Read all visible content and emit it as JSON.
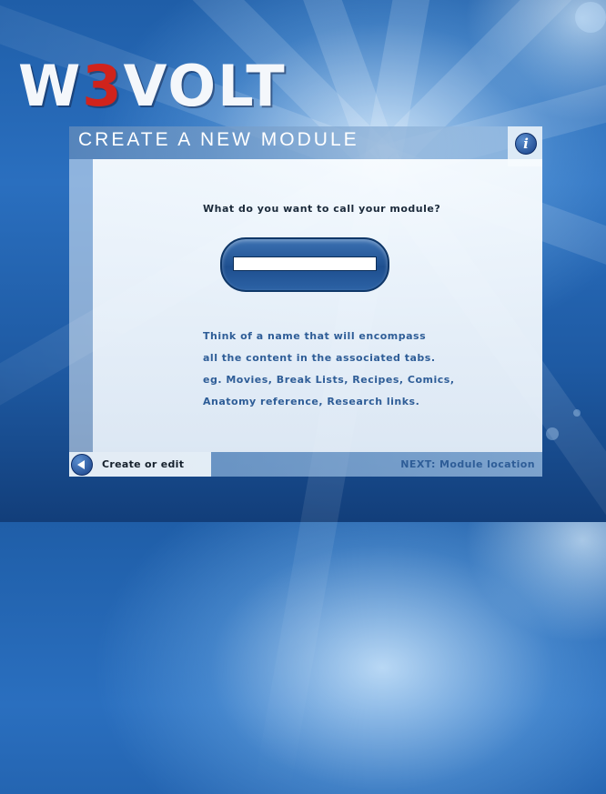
{
  "logo": {
    "part1": "W",
    "part2": "3",
    "part3": "VOLT"
  },
  "panel": {
    "title": "CREATE A NEW MODULE",
    "info_icon_glyph": "i",
    "question": "What do you want to call your module?",
    "name_input": {
      "value": "",
      "placeholder": ""
    },
    "hint_lines": [
      "Think of a name that will encompass",
      "all the content in the associated tabs.",
      "eg. Movies, Break Lists, Recipes, Comics,",
      "Anatomy reference, Research links."
    ]
  },
  "footer": {
    "back_label": "Create or edit",
    "next_label": "NEXT: Module location"
  },
  "colors": {
    "accent_red": "#d0231c",
    "link_blue": "#2e5d97",
    "background_blue": "#1f5ea8"
  }
}
